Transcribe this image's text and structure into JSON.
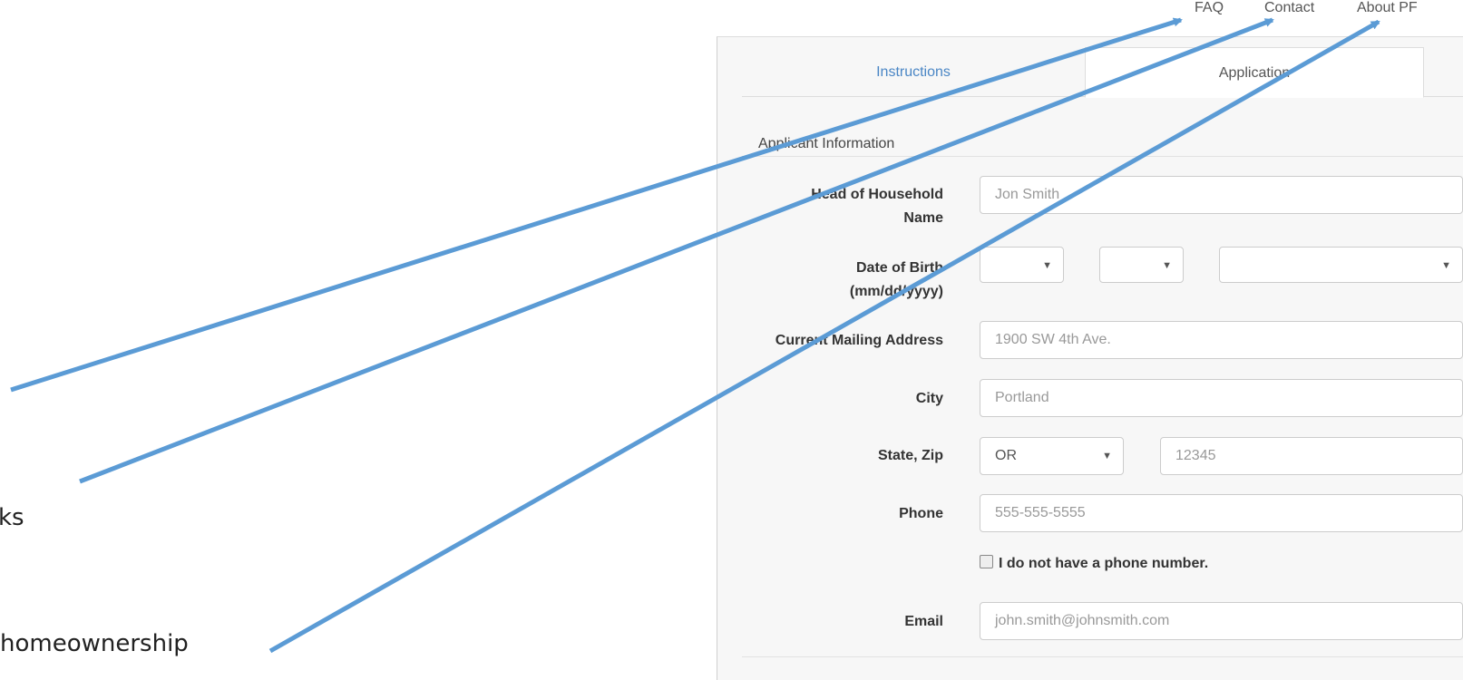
{
  "annotations": {
    "text1": "ks",
    "text2": "homeownership"
  },
  "nav": {
    "faq": "FAQ",
    "contact": "Contact",
    "about": "About PF"
  },
  "tabs": {
    "instructions": "Instructions",
    "application": "Application"
  },
  "section": {
    "title": "Applicant Information"
  },
  "form": {
    "head_label_1": "Head of Household",
    "head_label_2": "Name",
    "head_placeholder": "Jon Smith",
    "dob_label_1": "Date of Birth",
    "dob_label_2": "(mm/dd/yyyy)",
    "address_label": "Current Mailing Address",
    "address_placeholder": "1900 SW 4th Ave.",
    "city_label": "City",
    "city_placeholder": "Portland",
    "statezip_label": "State, Zip",
    "state_value": "OR",
    "zip_placeholder": "12345",
    "phone_label": "Phone",
    "phone_placeholder": "555-555-5555",
    "no_phone_label": "I do not have a phone number.",
    "email_label": "Email",
    "email_placeholder": "john.smith@johnsmith.com"
  },
  "colors": {
    "arrow": "#5b9bd5",
    "link": "#4a86c5",
    "panel_bg": "#f7f7f7"
  },
  "icons": {
    "caret": "caret-down-icon",
    "checkbox": "checkbox-icon"
  }
}
